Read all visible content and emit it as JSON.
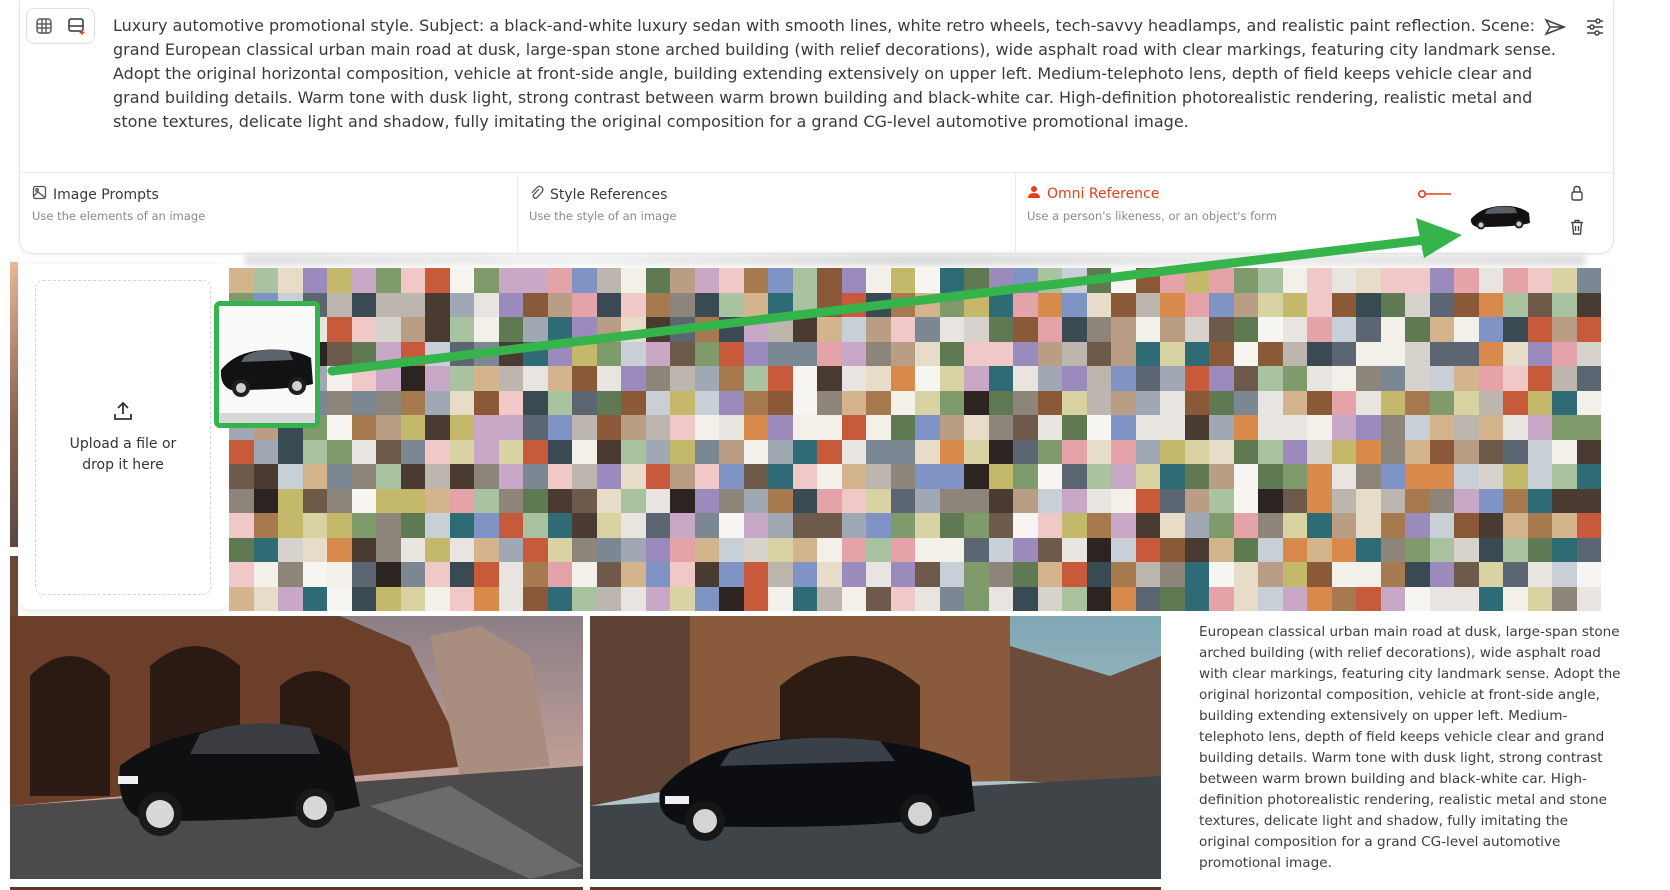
{
  "prompt": {
    "text": "Luxury automotive promotional style. Subject: a black-and-white luxury sedan with smooth lines, white retro wheels, tech-savvy headlamps, and realistic paint reflection. Scene: grand European classical urban main road at dusk, large-span stone arched building (with relief decorations), wide asphalt road with clear markings, featuring city landmark sense. Adopt the original horizontal composition, vehicle at front-side angle, building extending extensively on upper left. Medium-telephoto lens, depth of field keeps vehicle clear and grand building details. Warm tone with dusk light, strong contrast between warm brown building and black-white car. High-definition photorealistic rendering, realistic metal and stone textures, delicate light and shadow, fully imitating the original composition for a grand CG-level automotive promotional image."
  },
  "toolbar": {
    "left_icons": [
      "grid-icon",
      "image-add-icon"
    ],
    "right_icons": [
      "send-icon",
      "sliders-icon"
    ]
  },
  "references": {
    "image_prompts": {
      "title": "Image Prompts",
      "subtitle": "Use the elements of an image",
      "icon": "image-icon"
    },
    "style_references": {
      "title": "Style References",
      "subtitle": "Use the style of an image",
      "icon": "paperclip-icon"
    },
    "omni_reference": {
      "title": "Omni Reference",
      "subtitle": "Use a person's likeness, or an object's form",
      "icon": "person-icon",
      "active_color": "#e0401c"
    }
  },
  "side_icons": [
    "lock-icon",
    "trash-icon"
  ],
  "upload": {
    "label": "Upload a file or drop it here",
    "icon": "upload-icon"
  },
  "caption": {
    "text": "European classical urban main road at dusk, large-span stone arched building (with relief decorations), wide asphalt road with clear markings, featuring city landmark sense. Adopt the original horizontal composition, vehicle at front-side angle, building extending extensively on upper left. Medium-telephoto lens, depth of field keeps vehicle clear and grand building details. Warm tone with dusk light, strong contrast between warm brown building and black-white car. High-definition photorealistic rendering, realistic metal and stone textures, delicate light and shadow, fully imitating the original composition for a grand CG-level automotive promotional image."
  },
  "colors": {
    "annotation_green": "#34b44b",
    "accent": "#e0401c"
  }
}
